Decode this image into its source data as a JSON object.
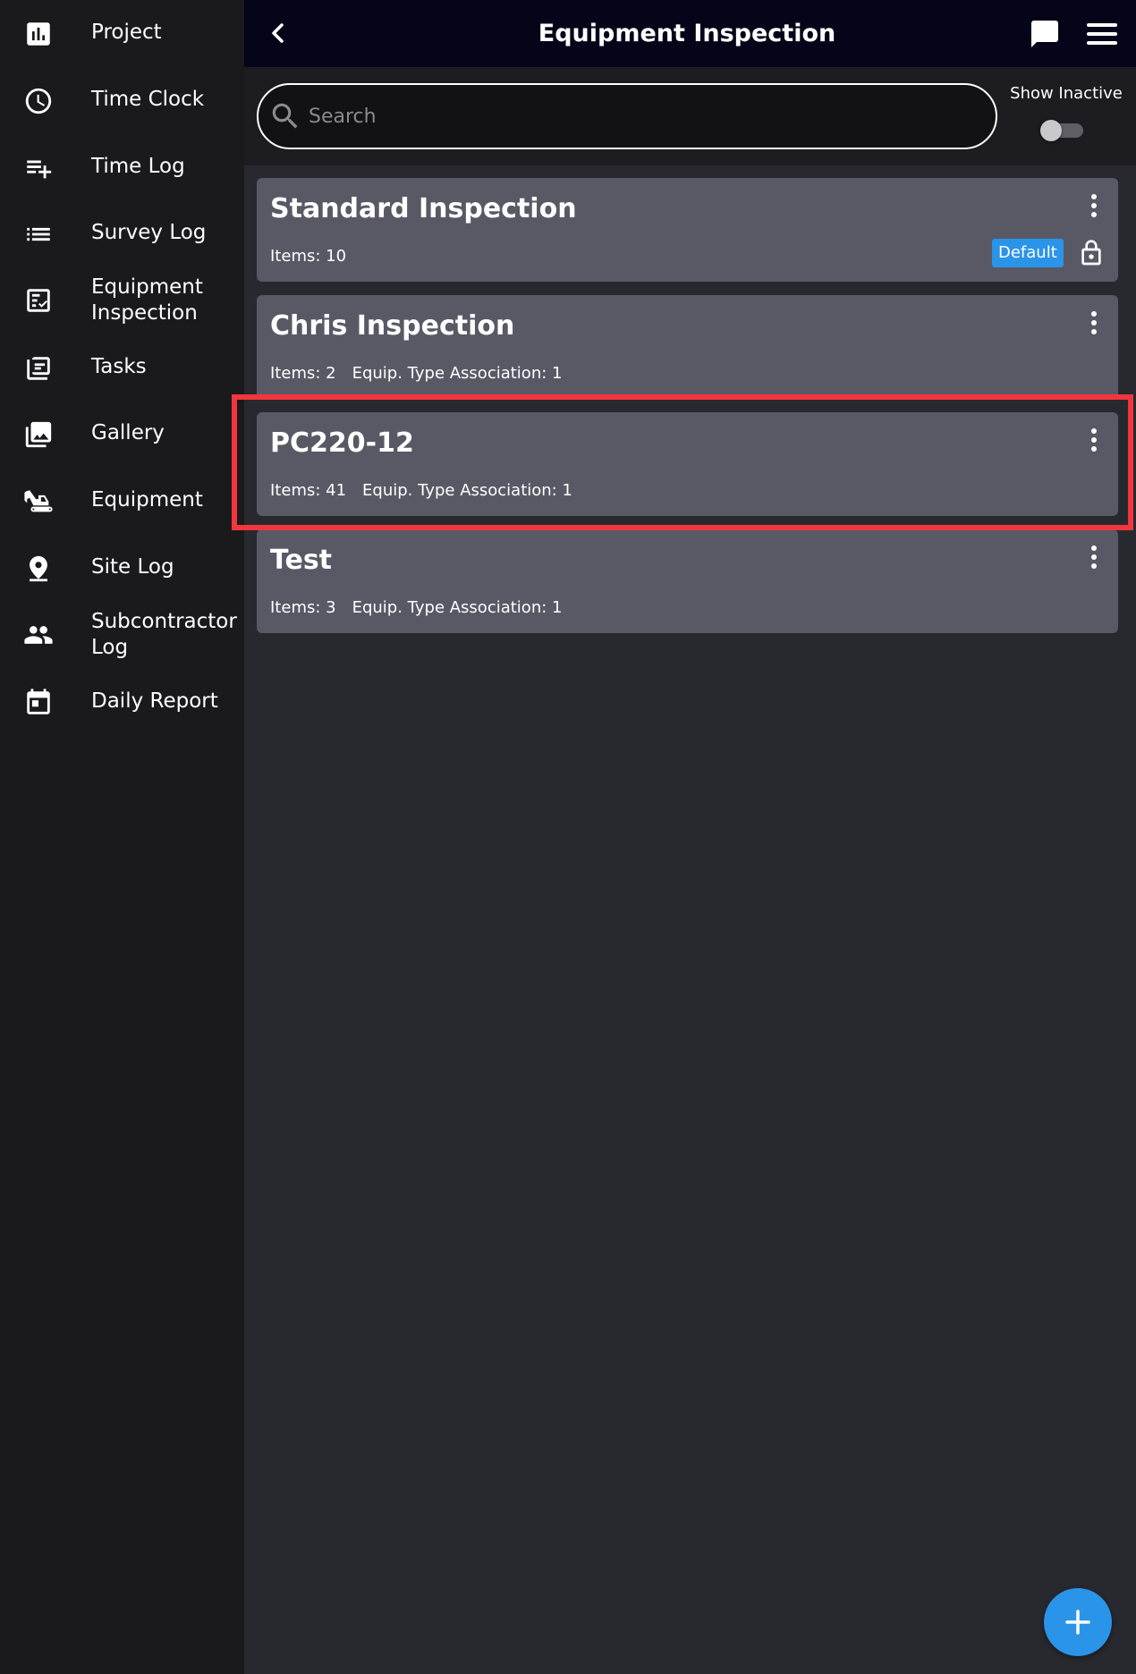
{
  "app": {
    "title": "Equipment Inspection",
    "accent_color": "#2a94e8",
    "highlight_color": "#f2363d"
  },
  "sidebar": {
    "items": [
      {
        "label": "Project",
        "icon": "bar-chart-icon"
      },
      {
        "label": "Time Clock",
        "icon": "clock-icon"
      },
      {
        "label": "Time Log",
        "icon": "playlist-add-icon"
      },
      {
        "label": "Survey Log",
        "icon": "list-icon"
      },
      {
        "label": "Equipment Inspection",
        "icon": "checklist-icon"
      },
      {
        "label": "Tasks",
        "icon": "tasks-icon"
      },
      {
        "label": "Gallery",
        "icon": "gallery-icon"
      },
      {
        "label": "Equipment",
        "icon": "excavator-icon"
      },
      {
        "label": "Site Log",
        "icon": "location-pin-icon"
      },
      {
        "label": "Subcontractor Log",
        "icon": "people-icon"
      },
      {
        "label": "Daily Report",
        "icon": "calendar-icon"
      }
    ]
  },
  "header": {
    "title": "Equipment Inspection",
    "back_icon": "chevron-left-icon",
    "chat_icon": "chat-icon",
    "menu_icon": "hamburger-menu-icon"
  },
  "search": {
    "placeholder": "Search",
    "value": ""
  },
  "show_inactive": {
    "label": "Show Inactive",
    "enabled": false
  },
  "inspections": [
    {
      "title": "Standard Inspection",
      "items": "Items: 10",
      "association": "",
      "badge": "Default",
      "locked": true
    },
    {
      "title": "Chris Inspection",
      "items": "Items: 2",
      "association": "Equip. Type Association: 1",
      "badge": "",
      "locked": false
    },
    {
      "title": "PC220-12",
      "items": "Items: 41",
      "association": "Equip. Type Association: 1",
      "badge": "",
      "locked": false,
      "highlighted": true
    },
    {
      "title": "Test",
      "items": "Items: 3",
      "association": "Equip. Type Association: 1",
      "badge": "",
      "locked": false
    }
  ],
  "fab": {
    "icon": "plus-icon"
  }
}
